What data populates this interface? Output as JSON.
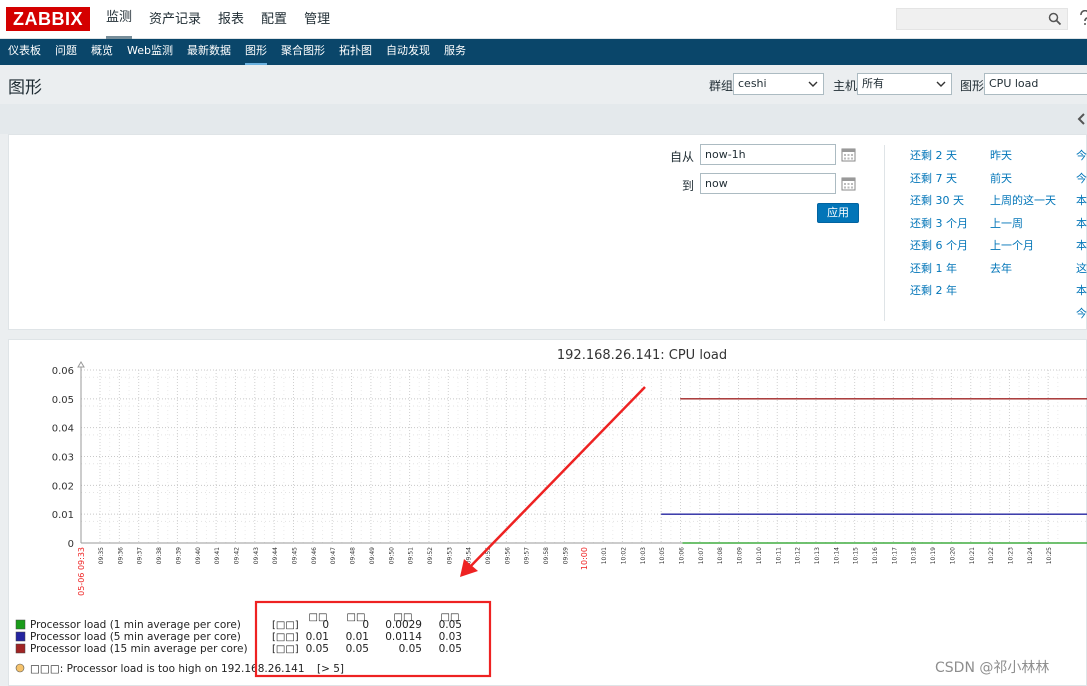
{
  "logo": "ZABBIX",
  "main_nav": [
    {
      "label": "监测",
      "active": true
    },
    {
      "label": "资产记录",
      "active": false
    },
    {
      "label": "报表",
      "active": false
    },
    {
      "label": "配置",
      "active": false
    },
    {
      "label": "管理",
      "active": false
    }
  ],
  "sub_nav": [
    {
      "label": "仪表板",
      "active": false
    },
    {
      "label": "问题",
      "active": false
    },
    {
      "label": "概览",
      "active": false
    },
    {
      "label": "Web监测",
      "active": false
    },
    {
      "label": "最新数据",
      "active": false
    },
    {
      "label": "图形",
      "active": true
    },
    {
      "label": "聚合图形",
      "active": false
    },
    {
      "label": "拓扑图",
      "active": false
    },
    {
      "label": "自动发现",
      "active": false
    },
    {
      "label": "服务",
      "active": false
    }
  ],
  "header": {
    "title": "图形",
    "group_label": "群组",
    "group_value": "ceshi",
    "host_label": "主机",
    "host_value": "所有",
    "graph_label": "图形",
    "graph_value": "CPU load"
  },
  "filter": {
    "from_label": "自从",
    "from_value": "now-1h",
    "to_label": "到",
    "to_value": "now",
    "apply_label": "应用",
    "quick_col1": [
      "还剩 2 天",
      "还剩 7 天",
      "还剩 30 天",
      "还剩 3 个月",
      "还剩 6 个月",
      "还剩 1 年",
      "还剩 2 年"
    ],
    "quick_col2": [
      "昨天",
      "前天",
      "上周的这一天",
      "上一周",
      "上一个月",
      "去年"
    ],
    "quick_col3": [
      "今",
      "今",
      "本",
      "本",
      "本",
      "这",
      "本",
      "今"
    ]
  },
  "chart_data": {
    "type": "line",
    "title": "192.168.26.141: CPU load",
    "yticks": [
      "0.06",
      "0.05",
      "0.04",
      "0.03",
      "0.02",
      "0.01",
      "0"
    ],
    "ylim": [
      0,
      0.06
    ],
    "x_start_label": "05-06 09:33",
    "x_ticks": [
      "09:35",
      "09:36",
      "09:37",
      "09:38",
      "09:39",
      "09:40",
      "09:41",
      "09:42",
      "09:43",
      "09:44",
      "09:45",
      "09:46",
      "09:47",
      "09:48",
      "09:49",
      "09:50",
      "09:51",
      "09:52",
      "09:53",
      "09:54",
      "09:55",
      "09:56",
      "09:57",
      "09:58",
      "09:59",
      "10:00",
      "10:01",
      "10:02",
      "10:03",
      "10:05",
      "10:06",
      "10:07",
      "10:08",
      "10:09",
      "10:10",
      "10:11",
      "10:12",
      "10:13",
      "10:14",
      "10:15",
      "10:16",
      "10:17",
      "10:18",
      "10:19",
      "10:20",
      "10:21",
      "10:22",
      "10:23",
      "10:24",
      "10:25"
    ],
    "highlight_ticks": [
      "05-06 09:33",
      "10:00"
    ],
    "series": [
      {
        "name": "Processor load (1 min average per core)",
        "color": "#1a9c1a",
        "value": 0,
        "starts_at": "10:06"
      },
      {
        "name": "Processor load (5 min average per core)",
        "color": "#2424a0",
        "value": 0.01,
        "starts_at": "10:05"
      },
      {
        "name": "Processor load (15 min average per core)",
        "color": "#a02424",
        "value": 0.05,
        "starts_at": "10:04"
      }
    ],
    "legend_headers": [
      "□□",
      "□□",
      "□□",
      "□□"
    ],
    "legend_rows": [
      {
        "tag": "[□□]",
        "values": [
          "0",
          "0",
          "0.0029",
          "0.05"
        ]
      },
      {
        "tag": "[□□]",
        "values": [
          "0.01",
          "0.01",
          "0.0114",
          "0.03"
        ]
      },
      {
        "tag": "[□□]",
        "values": [
          "0.05",
          "0.05",
          "0.05",
          "0.05"
        ]
      }
    ],
    "trigger_text": "□□□: Processor load is too high on 192.168.26.141",
    "trigger_threshold": "[> 5]",
    "annotation_color": "#ee2222"
  },
  "watermark": "CSDN @祁小林林"
}
